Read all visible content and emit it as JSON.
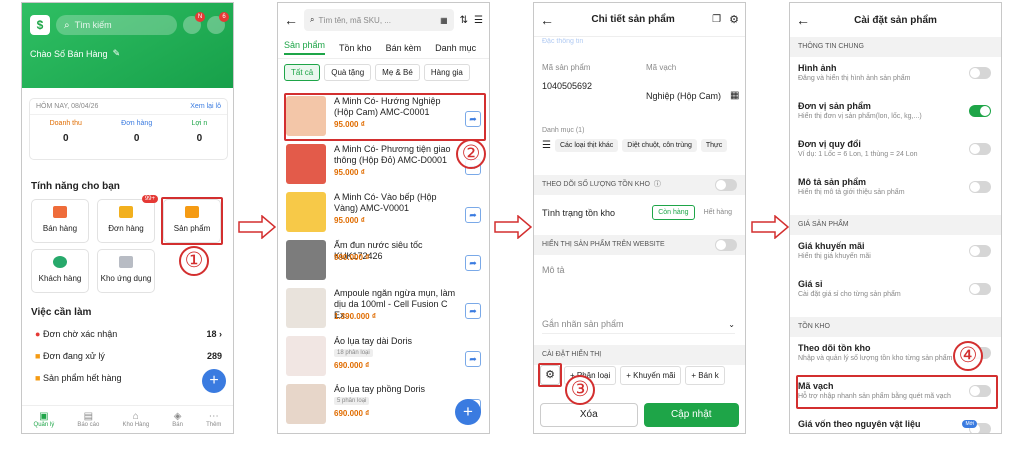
{
  "colors": {
    "brand": "#1ea548",
    "accent_orange": "#e06c00",
    "callout": "#d32f2f",
    "link_blue": "#3a7be0"
  },
  "screen1": {
    "search_placeholder": "Tìm kiếm",
    "greeting": "Chào Số Bán Hàng",
    "date": "HÔM NAY, 08/04/26",
    "view_again": "Xem lại lô",
    "stats": [
      {
        "label": "Doanh thu",
        "value": "0"
      },
      {
        "label": "Đơn hàng",
        "value": "0"
      },
      {
        "label": "Lợi n",
        "value": "0"
      }
    ],
    "features_title": "Tính năng cho bạn",
    "features": [
      "Bán hàng",
      "Đơn hàng",
      "Sản phẩm",
      "Khách hàng",
      "Kho ứng dụng"
    ],
    "order_badge": "99+",
    "tasks_title": "Việc cần làm",
    "tasks": [
      {
        "label": "Đơn chờ xác nhận",
        "count": "18"
      },
      {
        "label": "Đơn đang xử lý",
        "count": "289"
      },
      {
        "label": "Sản phẩm hết hàng",
        "count": ""
      }
    ],
    "bottom_nav": [
      "Quản lý",
      "Báo cáo",
      "Kho Hàng",
      "Bán",
      "Thêm"
    ],
    "header_badges": [
      "N",
      "6"
    ],
    "fab_icon": "plus-icon"
  },
  "screen2": {
    "search_placeholder": "Tìm tên, mã SKU, ...",
    "tabs": [
      "Sản phẩm",
      "Tồn kho",
      "Bán kèm",
      "Danh mục"
    ],
    "chips": [
      "Tất cả",
      "Quà tặng",
      "Mẹ & Bé",
      "Hàng gia"
    ],
    "products": [
      {
        "name": "A Minh Có- Hướng Nghiệp (Hộp Cam) AMC-C0001",
        "price": "95.000 ₫",
        "tag": ""
      },
      {
        "name": "A Minh Có- Phương tiện giao thông (Hộp Đỏ) AMC-D0001",
        "price": "95.000 ₫",
        "tag": ""
      },
      {
        "name": "A Minh Có- Vào bếp (Hộp Vàng) AMC-V0001",
        "price": "95.000 ₫",
        "tag": ""
      },
      {
        "name": "Ấm đun nước siêu tốc KUK172426",
        "price": "990.000 ₫",
        "tag": ""
      },
      {
        "name": "Ampoule ngăn ngừa mụn, làm dịu da 100ml - Cell Fusion C Ex...",
        "price": "1.390.000 ₫",
        "tag": ""
      },
      {
        "name": "Áo lụa tay dài Doris",
        "price": "690.000 ₫",
        "tag": "18 phân loại"
      },
      {
        "name": "Áo lụa tay phồng Doris",
        "price": "690.000 ₫",
        "tag": "5 phân loại"
      }
    ]
  },
  "screen3": {
    "title": "Chi tiết sản phẩm",
    "cut_text": "Đặc thông tin",
    "sku_label": "Mã sản phẩm",
    "sku_value": "1040505692",
    "barcode_label": "Mã vạch",
    "barcode_value": "Nghiệp (Hộp Cam)",
    "category_label": "Danh mục (1)",
    "categories": [
      "Các loại thịt khác",
      "Diệt chuột, côn trùng",
      "Thực"
    ],
    "track_stock": "THEO DÕI SỐ LƯỢNG TỒN KHO",
    "stock_status_label": "Tình trạng tồn kho",
    "stock_in": "Còn hàng",
    "stock_out": "Hết hàng",
    "website_label": "HIỂN THỊ SẢN PHẨM TRÊN WEBSITE",
    "desc_label": "Mô tả",
    "label_field": "Gắn nhãn sản phẩm",
    "display_settings": "CÀI ĐẶT HIỂN THỊ",
    "chips": [
      "+ Phân loại",
      "+ Khuyến mãi",
      "+ Bán k"
    ],
    "delete": "Xóa",
    "update": "Cập nhật"
  },
  "screen4": {
    "title": "Cài đặt sản phẩm",
    "sections": [
      {
        "name": "THÔNG TIN CHUNG",
        "rows": [
          {
            "title": "Hình ảnh",
            "desc": "Đăng và hiển thị hình ảnh sản phẩm",
            "on": false
          },
          {
            "title": "Đơn vị sản phẩm",
            "desc": "Hiển thị đơn vị sản phẩm(lon, lốc, kg,...)",
            "on": true
          },
          {
            "title": "Đơn vị quy đổi",
            "desc": "Ví dụ: 1 Lốc = 6 Lon, 1 thùng = 24 Lon",
            "on": false
          },
          {
            "title": "Mô tả sản phẩm",
            "desc": "Hiển thị mô tả giới thiệu sản phẩm",
            "on": false
          }
        ]
      },
      {
        "name": "GIÁ SẢN PHẨM",
        "rows": [
          {
            "title": "Giá khuyến mãi",
            "desc": "Hiển thị giá khuyến mãi",
            "on": false
          },
          {
            "title": "Giá sỉ",
            "desc": "Cài đặt giá sỉ cho từng sản phẩm",
            "on": false
          }
        ]
      },
      {
        "name": "TỒN KHO",
        "rows": [
          {
            "title": "Theo dõi tồn kho",
            "desc": "Nhập và quản lý số lượng tồn kho từng sản phẩm",
            "on": false
          },
          {
            "title": "Mã vạch",
            "desc": "Hỗ trợ nhập nhanh sản phẩm bằng quét mã vạch",
            "on": false
          },
          {
            "title": "Giá vốn theo nguyên vật liệu",
            "desc": "",
            "on": false
          }
        ]
      }
    ],
    "badge": "Mới"
  },
  "steps": [
    "①",
    "②",
    "③",
    "④"
  ]
}
